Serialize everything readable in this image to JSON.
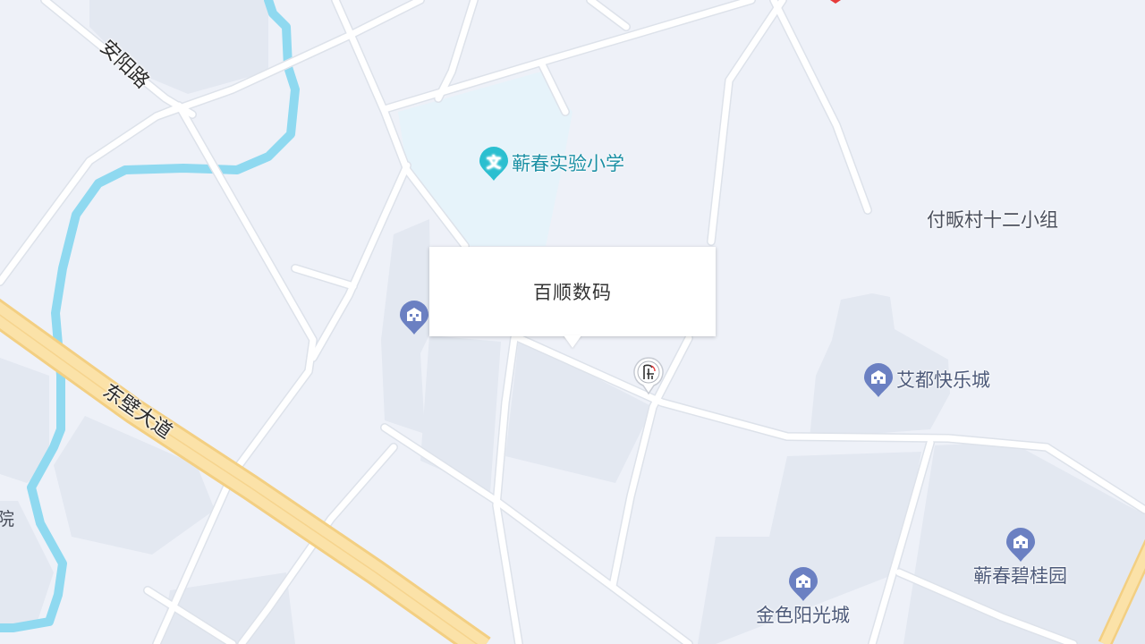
{
  "map": {
    "colors": {
      "background": "#eef1f8",
      "block": "#e3e8f1",
      "school_area": "#e6f3fa",
      "road": "#ffffff",
      "road_casing": "#dde2ea",
      "highway_fill": "#fbe2a8",
      "highway_casing": "#f3cf82",
      "river": "#8fd9f0",
      "school_pin": "#2bbfd0",
      "estate_pin": "#6b80c2",
      "location_marker": "#e63b3b"
    },
    "roads": {
      "anyang": "安阳路",
      "dongbi": "东壁大道"
    },
    "pois": {
      "school": {
        "label": "蕲春实验小学",
        "icon": "school-icon"
      },
      "fufan": {
        "label": "付畈村十二小组"
      },
      "aidu": {
        "label": "艾都快乐城",
        "icon": "building-icon"
      },
      "bgy": {
        "label": "蕲春碧桂园",
        "icon": "building-icon"
      },
      "jinse": {
        "label": "金色阳光城",
        "icon": "building-icon"
      },
      "unnamed_estate": {
        "icon": "building-icon"
      },
      "edge_partial": "院"
    },
    "popup": {
      "title": "百顺数码"
    },
    "shop_marker": {
      "icon": "shop-icon"
    }
  }
}
